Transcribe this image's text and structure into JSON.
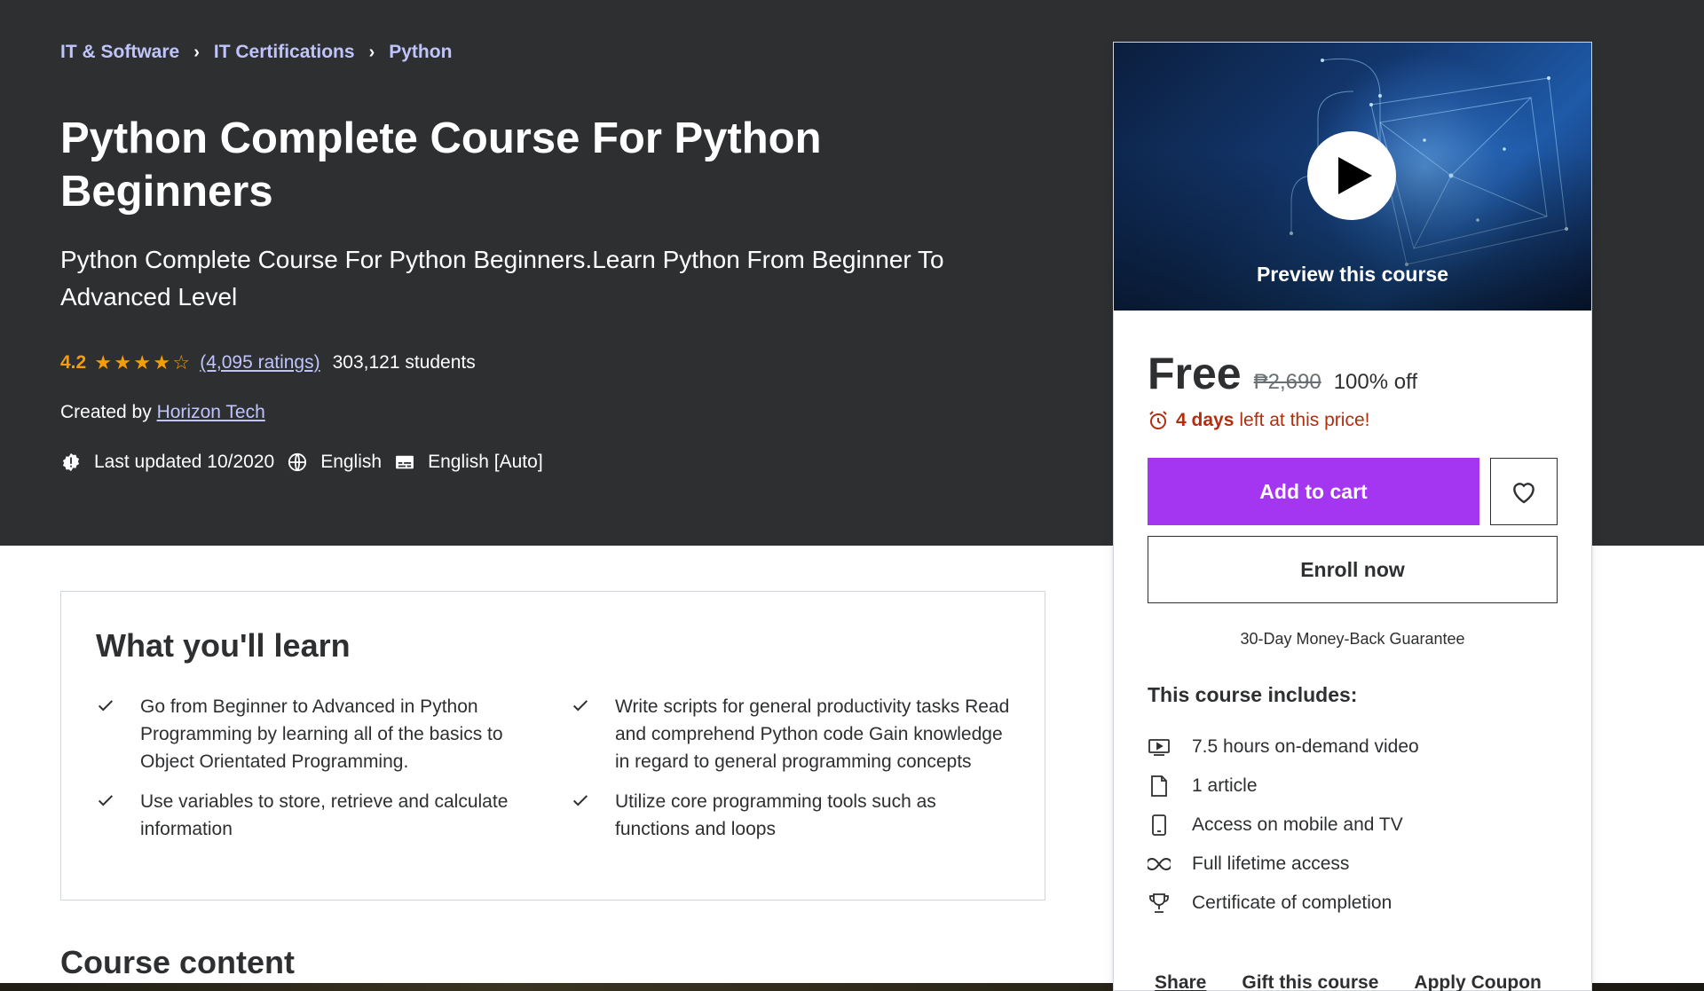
{
  "breadcrumb": [
    {
      "label": "IT & Software"
    },
    {
      "label": "IT Certifications"
    },
    {
      "label": "Python"
    }
  ],
  "course": {
    "title": "Python Complete Course For Python Beginners",
    "subtitle": "Python Complete Course For Python Beginners.Learn Python From Beginner To Advanced Level",
    "rating": "4.2",
    "rating_value": 4.2,
    "ratings_link": "(4,095 ratings)",
    "students": "303,121 students",
    "created_by_label": "Created by",
    "instructor": "Horizon Tech",
    "last_updated": "Last updated 10/2020",
    "language": "English",
    "captions": "English [Auto]"
  },
  "card": {
    "preview_label": "Preview this course",
    "price": "Free",
    "original_price": "₱2,690",
    "discount": "100% off",
    "countdown_bold": "4 days",
    "countdown_rest": "left at this price!",
    "add_to_cart": "Add to cart",
    "enroll_now": "Enroll now",
    "guarantee": "30-Day Money-Back Guarantee",
    "includes_title": "This course includes:",
    "includes": [
      {
        "icon": "video-icon",
        "label": "7.5 hours on-demand video"
      },
      {
        "icon": "file-icon",
        "label": "1 article"
      },
      {
        "icon": "mobile-icon",
        "label": "Access on mobile and TV"
      },
      {
        "icon": "infinity-icon",
        "label": "Full lifetime access"
      },
      {
        "icon": "trophy-icon",
        "label": "Certificate of completion"
      }
    ],
    "share": "Share",
    "gift": "Gift this course",
    "coupon": "Apply Coupon"
  },
  "learn": {
    "title": "What you'll learn",
    "items": [
      {
        "text": "Go from Beginner to Advanced in Python Programming by learning all of the basics to Object Orientated Programming."
      },
      {
        "text": "Write scripts for general productivity tasks Read and comprehend Python code Gain knowledge in regard to general programming concepts"
      },
      {
        "text": "Use variables to store, retrieve and calculate information"
      },
      {
        "text": "Utilize core programming tools such as functions and loops"
      }
    ]
  },
  "course_content_title": "Course content",
  "colors": {
    "hero_bg": "#2d2f31",
    "link_purple": "#c0c4fc",
    "star": "#f69c08",
    "cart_purple": "#a435f0",
    "countdown_red": "#b32d0f"
  }
}
